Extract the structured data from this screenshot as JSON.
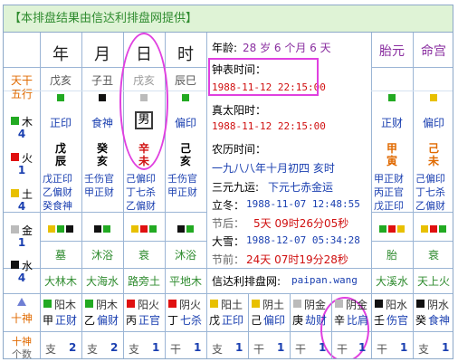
{
  "header": {
    "title": "【本排盘结果由信达利排盘网提供】"
  },
  "colors": {
    "wood": "#22aa22",
    "fire": "#e01010",
    "earth": "#e8c000",
    "metal": "#bbbbbb",
    "water": "#111111",
    "header_bg": "#dff3d6",
    "highlight": "#e040e0"
  },
  "pillars": {
    "headers": [
      "年",
      "月",
      "日",
      "时"
    ],
    "gan": [
      "戊亥",
      "子丑",
      "戌亥",
      "辰巳"
    ],
    "shishen": [
      "正印",
      "食神",
      "男",
      "偏印"
    ],
    "ganzhi": [
      [
        "戊",
        "辰"
      ],
      [
        "癸",
        "亥"
      ],
      [
        "辛",
        "未"
      ],
      [
        "己",
        "亥"
      ]
    ],
    "canggan": [
      [
        "戊正印",
        "乙偏财",
        "癸食神"
      ],
      [
        "壬伤官",
        "甲正财",
        ""
      ],
      [
        "己偏印",
        "丁七杀",
        "乙偏财"
      ],
      [
        "壬伤官",
        "甲正财",
        ""
      ]
    ],
    "shensha": [
      "墓",
      "沐浴",
      "衰",
      "沐浴"
    ],
    "nayin": [
      "大林木",
      "大海水",
      "路旁土",
      "平地木"
    ]
  },
  "left": {
    "tiangan_label": "天干",
    "wuxing_label": "五行",
    "shishen_label": "十神",
    "count_label": "个数"
  },
  "wuxing_counts": [
    {
      "name": "木",
      "count": "4",
      "color": "#22aa22"
    },
    {
      "name": "火",
      "count": "1",
      "color": "#e01010"
    },
    {
      "name": "土",
      "count": "4",
      "color": "#e8c000"
    },
    {
      "name": "金",
      "count": "1",
      "color": "#bbbbbb"
    },
    {
      "name": "水",
      "count": "4",
      "color": "#111111"
    }
  ],
  "info": {
    "age_label": "年龄:",
    "age_value": "28 岁 6 个月 6 天",
    "clock_label": "钟表时间：",
    "clock_value": "1988-11-12 22:15:00",
    "solar_label": "真太阳时：",
    "solar_value": "1988-11-12 22:15:00",
    "lunar_label": "农历时间：",
    "lunar_value": "一九八八年十月初四 亥时",
    "sanyuan_label": "三元九运:",
    "sanyuan_value": "下元七赤金运",
    "lidong_label": "立冬：",
    "lidong_value": "1988-11-07 12:48:55",
    "after_label": "节后：",
    "after_value": "5天 09时26分05秒",
    "daxue_label": "大雪：",
    "daxue_value": "1988-12-07 05:34:28",
    "before_label": "节前：",
    "before_value": "24天 07时19分28秒",
    "site_label": "信达利排盘网:",
    "site_value": "paipan.wang"
  },
  "taiyuan": {
    "header": "胎元",
    "gan": "正财",
    "ganzhi": [
      "甲",
      "寅"
    ],
    "canggan": [
      "甲正财",
      "丙正官",
      "戊正印"
    ],
    "shensha": "胎",
    "nayin": "大溪水"
  },
  "minggong": {
    "header": "命宫",
    "gan": "偏印",
    "ganzhi": [
      "己",
      "未"
    ],
    "canggan": [
      "己偏印",
      "丁七杀",
      "乙偏财"
    ],
    "shensha": "衰",
    "nayin": "天上火"
  },
  "bottom": {
    "cells": [
      {
        "yinyang": "阳木",
        "top": "甲",
        "rel": "正财"
      },
      {
        "yinyang": "阴木",
        "top": "乙",
        "rel": "偏财"
      },
      {
        "yinyang": "阳火",
        "top": "丙",
        "rel": "正官"
      },
      {
        "yinyang": "阴火",
        "top": "丁",
        "rel": "七杀"
      },
      {
        "yinyang": "阳土",
        "top": "戊",
        "rel": "正印"
      },
      {
        "yinyang": "阴土",
        "top": "己",
        "rel": "偏印"
      },
      {
        "yinyang": "阴金",
        "top": "庚",
        "rel": "劫财"
      },
      {
        "yinyang": "阴金",
        "top": "辛",
        "rel": "比肩"
      },
      {
        "yinyang": "阳水",
        "top": "壬",
        "rel": "伤官"
      },
      {
        "yinyang": "阴水",
        "top": "癸",
        "rel": "食神"
      }
    ],
    "counts": [
      {
        "label": "支",
        "value": "2"
      },
      {
        "label": "支",
        "value": "2"
      },
      {
        "label": "支",
        "value": "1"
      },
      {
        "label": "干",
        "value": "1"
      },
      {
        "label": "支",
        "value": "1"
      },
      {
        "label": "干",
        "value": "1"
      },
      {
        "label": "干",
        "value": "1"
      },
      {
        "label": "干",
        "value": "1"
      },
      {
        "label": "干",
        "value": "1"
      },
      {
        "label": "支",
        "value": "1"
      }
    ]
  }
}
